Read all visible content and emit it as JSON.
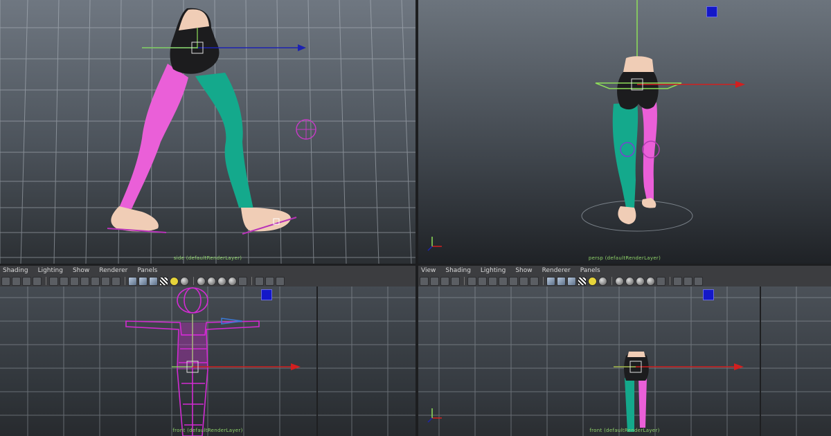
{
  "viewports": {
    "top_left": {
      "label": "side (defaultRenderLayer)"
    },
    "top_right": {
      "label": "persp (defaultRenderLayer)"
    },
    "bottom_left": {
      "label": "front (defaultRenderLayer)"
    },
    "bottom_right": {
      "label": "front (defaultRenderLayer)"
    }
  },
  "panel_menu_left": [
    "Shading",
    "Lighting",
    "Show",
    "Renderer",
    "Panels"
  ],
  "panel_menu_right": [
    "View",
    "Shading",
    "Lighting",
    "Show",
    "Renderer",
    "Panels"
  ],
  "icons": {
    "manipulator": "move-manipulator-icon",
    "axis": "view-axis-icon",
    "blue_square": "view-cube-icon"
  },
  "colors": {
    "pink_leg": "#ea5fd8",
    "teal_leg": "#14a98c",
    "shorts": "#1c1c1e",
    "skin": "#f0cdb6",
    "wire_magenta": "#d22bd2",
    "grid": "#aeb5bd",
    "axis_red": "#d21f1f",
    "axis_blue": "#1d23b0",
    "axis_green": "#8fe05a"
  }
}
